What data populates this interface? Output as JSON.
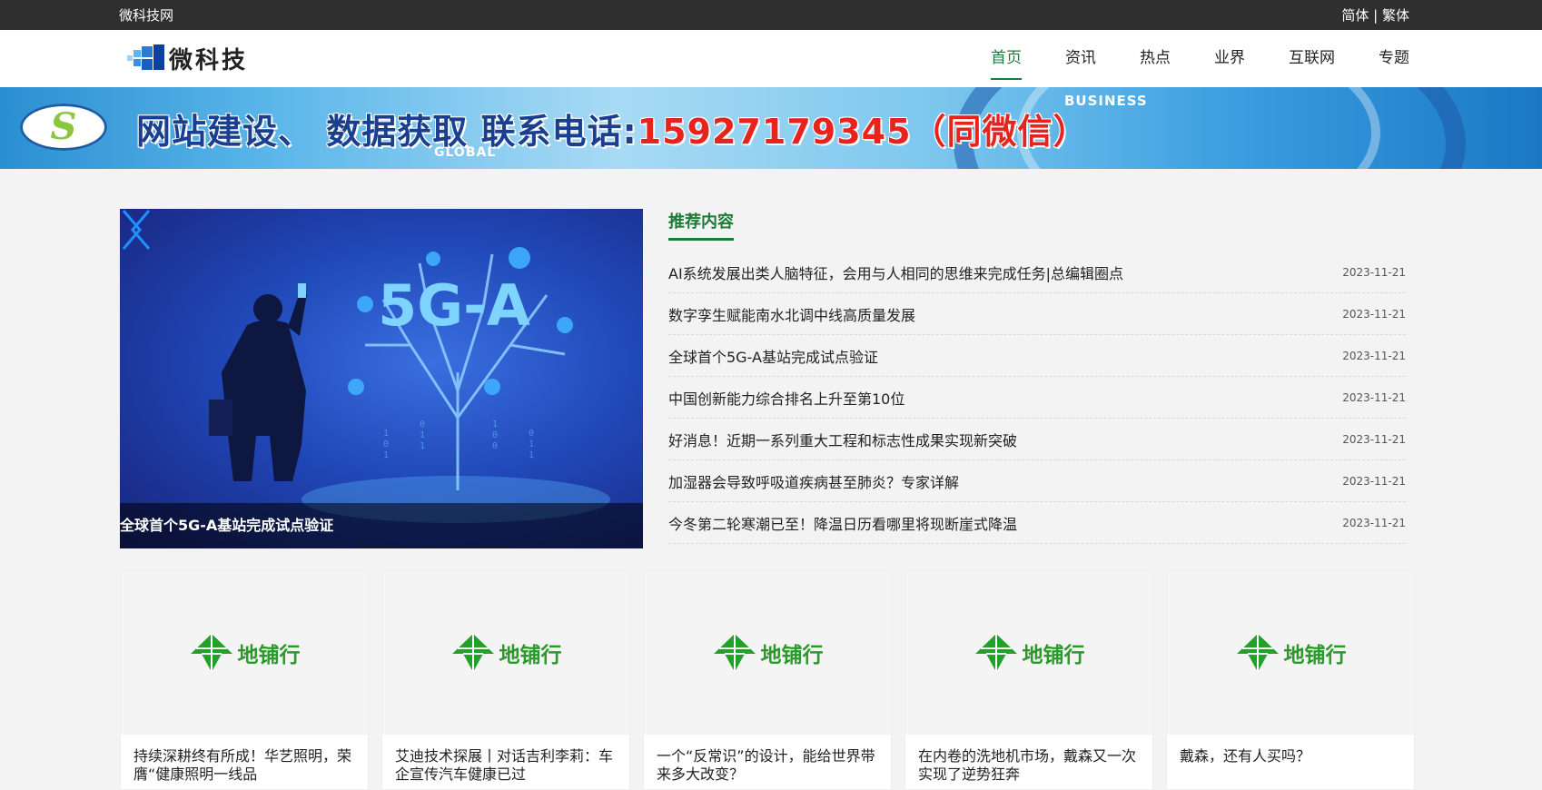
{
  "topbar": {
    "site_name": "微科技网",
    "lang_simplified": "简体",
    "lang_separator": " | ",
    "lang_traditional": "繁体"
  },
  "header": {
    "logo_text": "微科技",
    "nav": [
      "首页",
      "资讯",
      "热点",
      "业界",
      "互联网",
      "专题"
    ],
    "active_nav": "首页"
  },
  "banner": {
    "text_main": "网站建设、 数据获取 联系电话:",
    "phone": "15927179345",
    "text_suffix": "（同微信）",
    "word_business": "BUSINESS",
    "word_global": "GLOBAL"
  },
  "slider": {
    "image_label": "5G-A",
    "caption": "全球首个5G-A基站完成试点验证"
  },
  "recommend": {
    "title": "推荐内容",
    "items": [
      {
        "title": "AI系统发展出类人脑特征，会用与人相同的思维来完成任务|总编辑圈点",
        "date": "2023-11-21"
      },
      {
        "title": "数字孪生赋能南水北调中线高质量发展",
        "date": "2023-11-21"
      },
      {
        "title": "全球首个5G-A基站完成试点验证",
        "date": "2023-11-21"
      },
      {
        "title": "中国创新能力综合排名上升至第10位",
        "date": "2023-11-21"
      },
      {
        "title": "好消息！近期一系列重大工程和标志性成果实现新突破",
        "date": "2023-11-21"
      },
      {
        "title": "加湿器会导致呼吸道疾病甚至肺炎？专家详解",
        "date": "2023-11-21"
      },
      {
        "title": "今冬第二轮寒潮已至！降温日历看哪里将现断崖式降温",
        "date": "2023-11-21"
      }
    ]
  },
  "cards": [
    {
      "logo_text": "地铺行",
      "title": "持续深耕终有所成！华艺照明，荣膺“健康照明一线品"
    },
    {
      "logo_text": "地铺行",
      "title": "艾迪技术探展丨对话吉利李莉：车企宣传汽车健康已过"
    },
    {
      "logo_text": "地铺行",
      "title": "一个“反常识”的设计，能给世界带来多大改变？"
    },
    {
      "logo_text": "地铺行",
      "title": "在内卷的洗地机市场，戴森又一次实现了逆势狂奔"
    },
    {
      "logo_text": "地铺行",
      "title": "戴森，还有人买吗？"
    }
  ],
  "colors": {
    "accent": "#1a7a37",
    "topbar": "#2f2f2f",
    "card_logo": "#2a9a2a"
  }
}
